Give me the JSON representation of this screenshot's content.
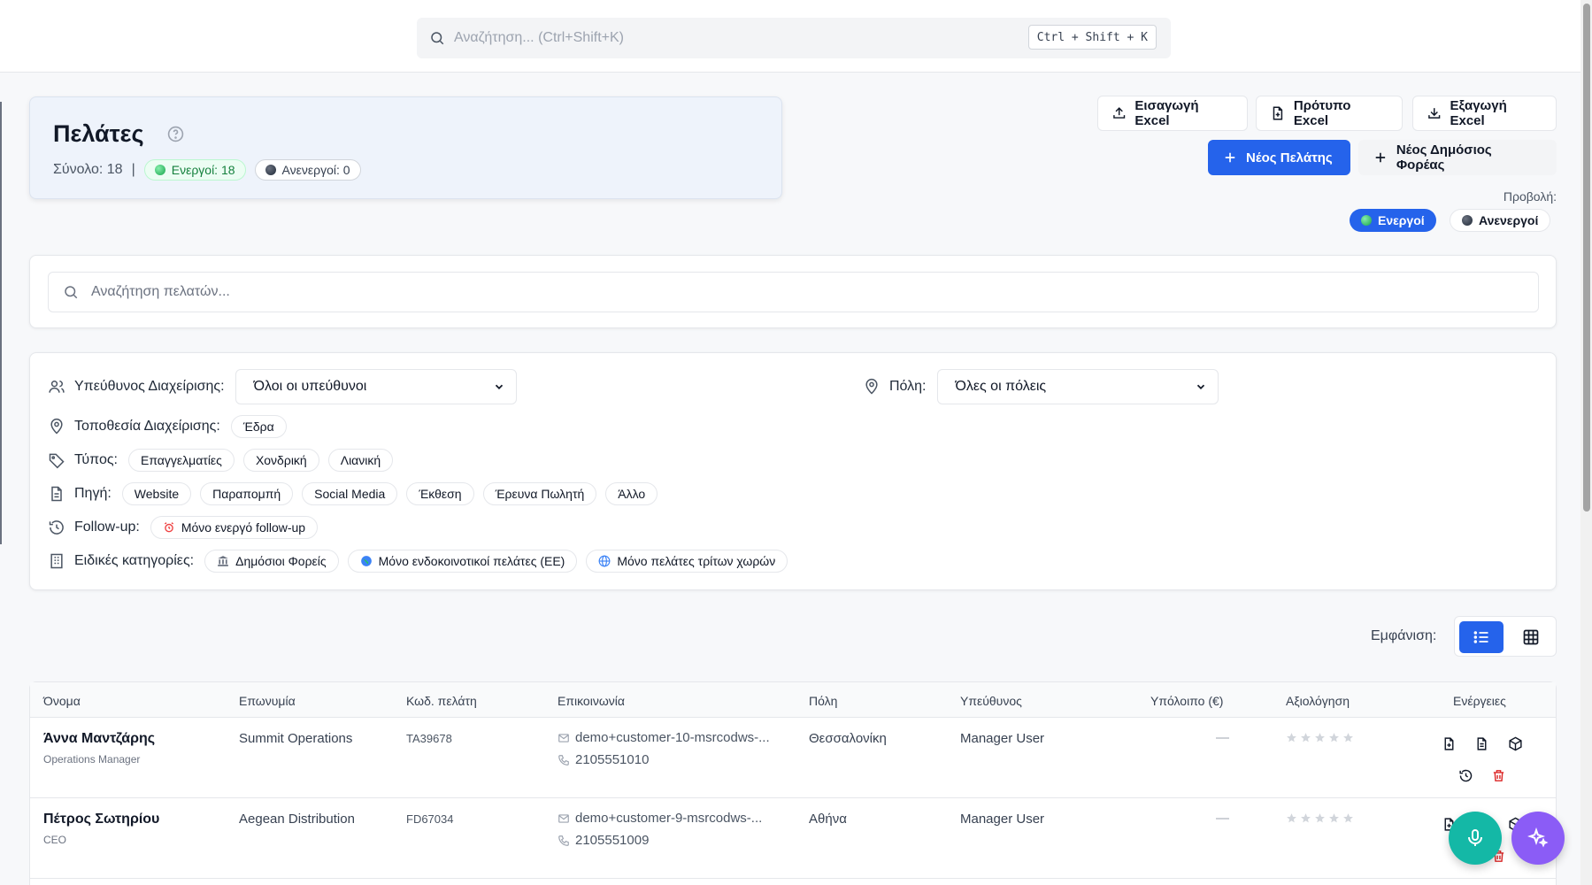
{
  "topbar": {
    "search_placeholder": "Αναζήτηση... (Ctrl+Shift+K)",
    "shortcut": "Ctrl + Shift + K"
  },
  "header": {
    "title": "Πελάτες",
    "total_label": "Σύνολο: 18",
    "separator": "|",
    "active_label": "Ενεργοί: 18",
    "inactive_label": "Ανενεργοί: 0"
  },
  "actions": {
    "import_excel": "Εισαγωγή Excel",
    "template_excel": "Πρότυπο Excel",
    "export_excel": "Εξαγωγή Excel",
    "new_customer": "Νέος Πελάτης",
    "new_public_body": "Νέος Δημόσιος Φορέας"
  },
  "view_filter": {
    "label": "Προβολή:",
    "active": "Ενεργοί",
    "inactive": "Ανενεργοί"
  },
  "customer_search": {
    "placeholder": "Αναζήτηση πελατών..."
  },
  "filters": {
    "manager_label": "Υπεύθυνος Διαχείρισης:",
    "manager_value": "Όλοι οι υπεύθυνοι",
    "city_label": "Πόλη:",
    "city_value": "Όλες οι πόλεις",
    "location_label": "Τοποθεσία Διαχείρισης:",
    "location_chips": [
      "Έδρα"
    ],
    "type_label": "Τύπος:",
    "type_chips": [
      "Επαγγελματίες",
      "Χονδρική",
      "Λιανική"
    ],
    "source_label": "Πηγή:",
    "source_chips": [
      "Website",
      "Παραπομπή",
      "Social Media",
      "Έκθεση",
      "Έρευνα Πωλητή",
      "Άλλο"
    ],
    "followup_label": "Follow-up:",
    "followup_chip": "Μόνο ενεργό follow-up",
    "special_label": "Ειδικές κατηγορίες:",
    "special_chips": [
      "Δημόσιοι Φορείς",
      "Μόνο ενδοκοινοτικοί πελάτες (ΕΕ)",
      "Μόνο πελάτες τρίτων χωρών"
    ]
  },
  "display": {
    "label": "Εμφάνιση:"
  },
  "table": {
    "columns": [
      "Όνομα",
      "Επωνυμία",
      "Κωδ. πελάτη",
      "Επικοινωνία",
      "Πόλη",
      "Υπεύθυνος",
      "Υπόλοιπο (€)",
      "Αξιολόγηση",
      "Ενέργειες"
    ],
    "rows": [
      {
        "name": "Άννα Μαντζάρης",
        "role": "Operations Manager",
        "company": "Summit Operations",
        "code": "TA39678",
        "email": "demo+customer-10-msrcodws-...",
        "phone": "2105551010",
        "city": "Θεσσαλονίκη",
        "manager": "Manager User",
        "balance": "—"
      },
      {
        "name": "Πέτρος Σωτηρίου",
        "role": "CEO",
        "company": "Aegean Distribution",
        "code": "FD67034",
        "email": "demo+customer-9-msrcodws-...",
        "phone": "2105551009",
        "city": "Αθήνα",
        "manager": "Manager User",
        "balance": "—"
      }
    ]
  },
  "colors": {
    "primary": "#2563eb",
    "mic_fab": "#14b8a6",
    "ai_fab": "#8b5cf6",
    "delete": "#dc2626"
  }
}
